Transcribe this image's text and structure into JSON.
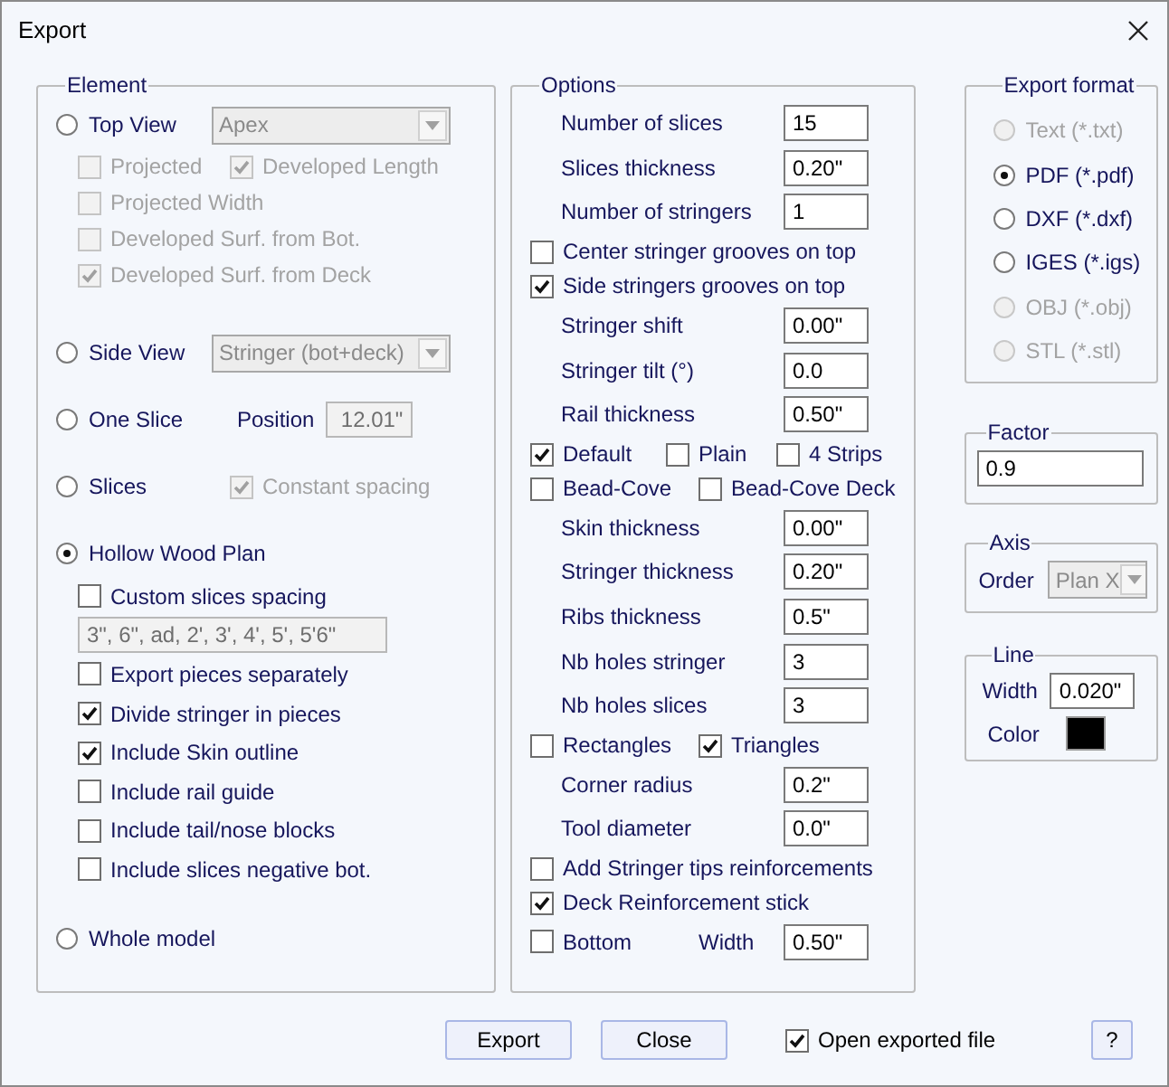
{
  "window": {
    "title": "Export"
  },
  "element": {
    "title": "Element",
    "options": [
      {
        "kind": "radio_dropdown",
        "label": "Top View",
        "selected": false,
        "dropdown": {
          "value": "Apex",
          "disabled": true
        },
        "children": [
          {
            "kind": "checks",
            "items": [
              {
                "label": "Projected",
                "checked": false,
                "disabled": true
              },
              {
                "label": "Developed Length",
                "checked": true,
                "disabled": true
              }
            ]
          },
          {
            "kind": "checks",
            "items": [
              {
                "label": "Projected Width",
                "checked": false,
                "disabled": true
              }
            ]
          },
          {
            "kind": "checks",
            "items": [
              {
                "label": "Developed Surf. from Bot.",
                "checked": false,
                "disabled": true
              }
            ]
          },
          {
            "kind": "checks",
            "items": [
              {
                "label": "Developed Surf. from Deck",
                "checked": true,
                "disabled": true
              }
            ]
          }
        ]
      },
      {
        "kind": "radio_dropdown",
        "label": "Side View",
        "selected": false,
        "dropdown": {
          "value": "Stringer (bot+deck)",
          "disabled": true
        }
      },
      {
        "kind": "radio_field",
        "label": "One Slice",
        "selected": false,
        "field_label": "Position",
        "field": {
          "value": "12.01\"",
          "disabled": true
        }
      },
      {
        "kind": "radio_check",
        "label": "Slices",
        "selected": false,
        "check": {
          "label": "Constant spacing",
          "checked": true,
          "disabled": true
        }
      },
      {
        "kind": "radio",
        "label": "Hollow Wood Plan",
        "selected": true,
        "children": [
          {
            "kind": "checks",
            "items": [
              {
                "label": "Custom slices spacing",
                "checked": false,
                "disabled": false
              }
            ]
          },
          {
            "kind": "text_field",
            "value": "3\", 6\", ad, 2', 3', 4', 5', 5'6\"",
            "disabled": true
          },
          {
            "kind": "checks",
            "items": [
              {
                "label": "Export pieces separately",
                "checked": false,
                "disabled": false
              }
            ]
          },
          {
            "kind": "checks",
            "items": [
              {
                "label": "Divide stringer in pieces",
                "checked": true,
                "disabled": false
              }
            ]
          },
          {
            "kind": "checks",
            "items": [
              {
                "label": "Include Skin outline",
                "checked": true,
                "disabled": false
              }
            ]
          },
          {
            "kind": "checks",
            "items": [
              {
                "label": "Include rail guide",
                "checked": false,
                "disabled": false
              }
            ]
          },
          {
            "kind": "checks",
            "items": [
              {
                "label": "Include tail/nose blocks",
                "checked": false,
                "disabled": false
              }
            ]
          },
          {
            "kind": "checks",
            "items": [
              {
                "label": "Include slices negative bot.",
                "checked": false,
                "disabled": false
              }
            ]
          }
        ]
      },
      {
        "kind": "radio",
        "label": "Whole model",
        "selected": false
      }
    ]
  },
  "options": {
    "title": "Options",
    "rows": [
      {
        "kind": "field",
        "label": "Number of slices",
        "value": "15"
      },
      {
        "kind": "field",
        "label": "Slices thickness",
        "value": "0.20\""
      },
      {
        "kind": "field",
        "label": "Number of stringers",
        "value": "1"
      },
      {
        "kind": "checks",
        "items": [
          {
            "label": "Center stringer grooves on top",
            "checked": false
          }
        ]
      },
      {
        "kind": "checks",
        "items": [
          {
            "label": "Side stringers grooves on top",
            "checked": true
          }
        ]
      },
      {
        "kind": "field",
        "label": "Stringer shift",
        "value": "0.00\""
      },
      {
        "kind": "field",
        "label": "Stringer tilt (°)",
        "value": "0.0"
      },
      {
        "kind": "field",
        "label": "Rail thickness",
        "value": "0.50\""
      },
      {
        "kind": "checks",
        "items": [
          {
            "label": "Default",
            "checked": true
          },
          {
            "label": "Plain",
            "checked": false
          },
          {
            "label": "4 Strips",
            "checked": false
          }
        ]
      },
      {
        "kind": "checks",
        "items": [
          {
            "label": "Bead-Cove",
            "checked": false
          },
          {
            "label": "Bead-Cove Deck",
            "checked": false
          }
        ]
      },
      {
        "kind": "field",
        "label": "Skin thickness",
        "value": "0.00\""
      },
      {
        "kind": "field",
        "label": "Stringer thickness",
        "value": "0.20\""
      },
      {
        "kind": "field",
        "label": "Ribs thickness",
        "value": "0.5\""
      },
      {
        "kind": "field",
        "label": "Nb holes stringer",
        "value": "3"
      },
      {
        "kind": "field",
        "label": "Nb holes slices",
        "value": "3"
      },
      {
        "kind": "checks",
        "items": [
          {
            "label": "Rectangles",
            "checked": false
          },
          {
            "label": "Triangles",
            "checked": true
          }
        ]
      },
      {
        "kind": "field",
        "label": "Corner radius",
        "value": "0.2\""
      },
      {
        "kind": "field",
        "label": "Tool diameter",
        "value": "0.0\""
      },
      {
        "kind": "checks",
        "items": [
          {
            "label": "Add Stringer tips reinforcements",
            "checked": false
          }
        ]
      },
      {
        "kind": "checks",
        "items": [
          {
            "label": "Deck Reinforcement stick",
            "checked": true
          }
        ]
      },
      {
        "kind": "check_field",
        "check": {
          "label": "Bottom",
          "checked": false
        },
        "field_label": "Width",
        "value": "0.50\""
      }
    ]
  },
  "export_format": {
    "title": "Export format",
    "options": [
      {
        "label": "Text (*.txt)",
        "selected": false,
        "disabled": true
      },
      {
        "label": "PDF (*.pdf)",
        "selected": true,
        "disabled": false
      },
      {
        "label": "DXF (*.dxf)",
        "selected": false,
        "disabled": false
      },
      {
        "label": "IGES (*.igs)",
        "selected": false,
        "disabled": false
      },
      {
        "label": "OBJ (*.obj)",
        "selected": false,
        "disabled": true
      },
      {
        "label": "STL (*.stl)",
        "selected": false,
        "disabled": true
      }
    ]
  },
  "factor": {
    "title": "Factor",
    "value": "0.9"
  },
  "axis": {
    "title": "Axis",
    "label": "Order",
    "dropdown": {
      "value": "Plan X",
      "disabled": true
    }
  },
  "line": {
    "title": "Line",
    "width_label": "Width",
    "width_value": "0.020\"",
    "color_label": "Color",
    "color": "#000000"
  },
  "footer": {
    "buttons": [
      {
        "label": "Export"
      },
      {
        "label": "Close"
      }
    ],
    "open_file": {
      "label": "Open exported file",
      "checked": true
    },
    "help": "?"
  }
}
